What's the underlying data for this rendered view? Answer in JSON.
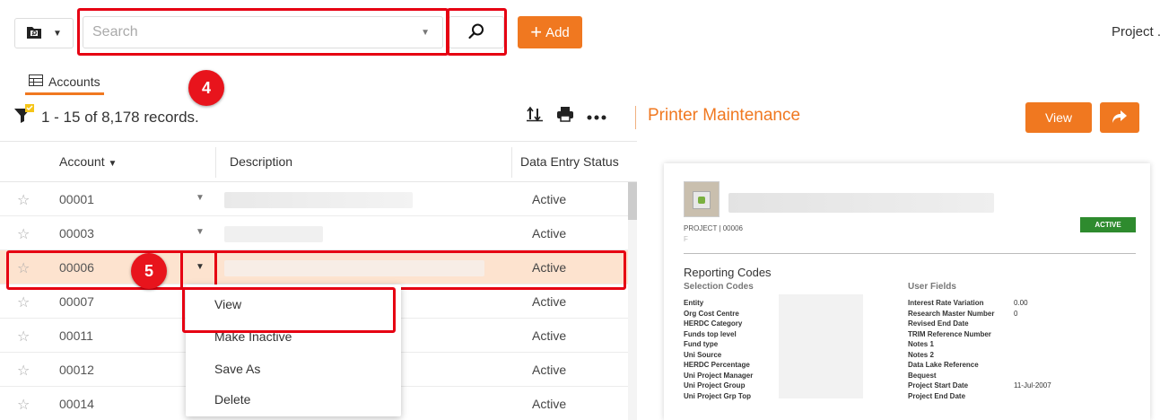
{
  "search": {
    "placeholder": "Search"
  },
  "add_button": {
    "label": "Add"
  },
  "header": {
    "project_label": "Project ."
  },
  "tab": {
    "label": "Accounts"
  },
  "records": {
    "summary": "1 - 15 of 8,178 records."
  },
  "annotations": {
    "badge_4": "4",
    "badge_5": "5"
  },
  "record": {
    "title": "Printer Maintenance",
    "view_label": "View"
  },
  "table": {
    "headers": {
      "account": "Account",
      "description": "Description",
      "status": "Data Entry Status"
    },
    "rows": [
      {
        "account": "00001",
        "status": "Active"
      },
      {
        "account": "00003",
        "status": "Active"
      },
      {
        "account": "00006",
        "status": "Active"
      },
      {
        "account": "00007",
        "status": "Active"
      },
      {
        "account": "00011",
        "status": "Active"
      },
      {
        "account": "00012",
        "status": "Active"
      },
      {
        "account": "00014",
        "status": "Active"
      }
    ]
  },
  "context_menu": {
    "items": [
      "View",
      "Make Inactive",
      "Save As",
      "Delete"
    ]
  },
  "preview": {
    "subtitle": "PROJECT | 00006",
    "sub2": "F",
    "status_badge": "ACTIVE",
    "section_title": "Reporting Codes",
    "selection_codes_title": "Selection Codes",
    "user_fields_title": "User Fields",
    "selection_codes": [
      "Entity",
      "Org Cost Centre",
      "HERDC Category",
      "Funds top level",
      "Fund type",
      "Uni Source",
      "HERDC Percentage",
      "Uni Project Manager",
      "Uni Project Group",
      "Uni Project Grp Top"
    ],
    "user_fields": [
      "Interest Rate Variation",
      "Research Master Number",
      "Revised End Date",
      "TRIM Reference Number",
      "Notes 1",
      "Notes 2",
      "Data Lake Reference",
      "Bequest",
      "Project Start Date",
      "Project End Date"
    ],
    "user_field_values": [
      "0.00",
      "0",
      "",
      "",
      "",
      "",
      "",
      "",
      "11-Jul-2007",
      ""
    ]
  },
  "colors": {
    "accent": "#f07820",
    "highlight": "#e60012",
    "active_green": "#2e8b2e"
  },
  "icons": [
    "folder-search-icon",
    "search-icon",
    "plus-icon",
    "table-icon",
    "filter-icon",
    "sort-icon",
    "print-icon",
    "more-icon",
    "next-record-icon",
    "star-icon"
  ]
}
